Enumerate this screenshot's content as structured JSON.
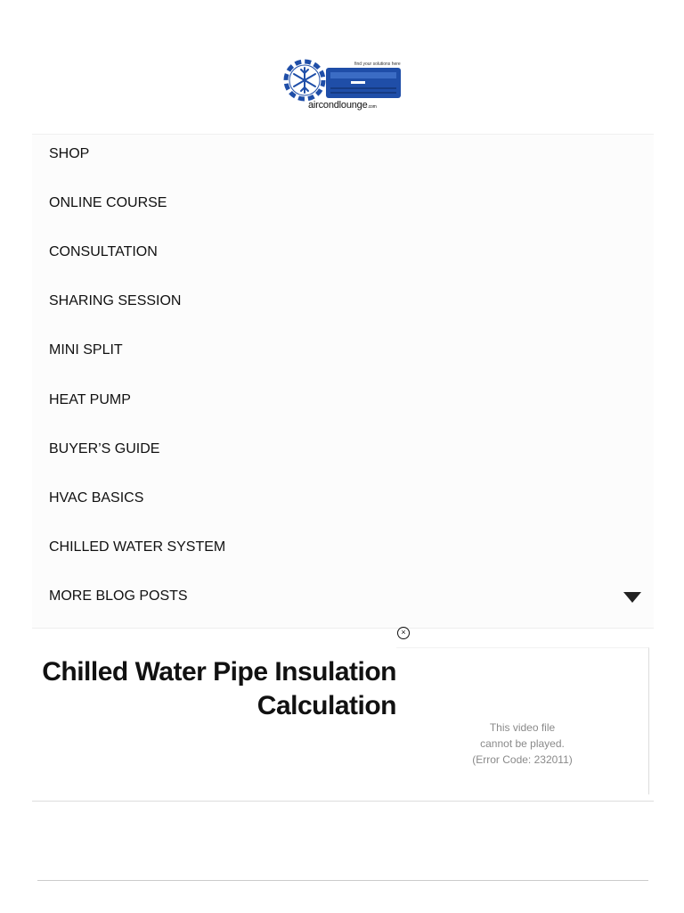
{
  "logo": {
    "tagline": "find your solutions here",
    "wordmark": "aircondlounge",
    "wordmark_suffix": ".com",
    "brand_color": "#1f4ea8"
  },
  "nav": {
    "items": [
      {
        "label": "SHOP"
      },
      {
        "label": "ONLINE COURSE"
      },
      {
        "label": "CONSULTATION"
      },
      {
        "label": "SHARING SESSION"
      },
      {
        "label": "MINI SPLIT"
      },
      {
        "label": "HEAT PUMP"
      },
      {
        "label": "BUYER’S GUIDE"
      },
      {
        "label": "HVAC BASICS"
      },
      {
        "label": "CHILLED WATER SYSTEM"
      },
      {
        "label": "MORE BLOG POSTS"
      }
    ],
    "expand_icon": "caret-down-icon"
  },
  "ad": {
    "close_glyph": "×"
  },
  "article": {
    "title": "Chilled Water Pipe Insulation Calculation"
  },
  "video": {
    "error_line1": "This video file",
    "error_line2": "cannot be played.",
    "error_line3": "(Error Code: 232011)"
  }
}
